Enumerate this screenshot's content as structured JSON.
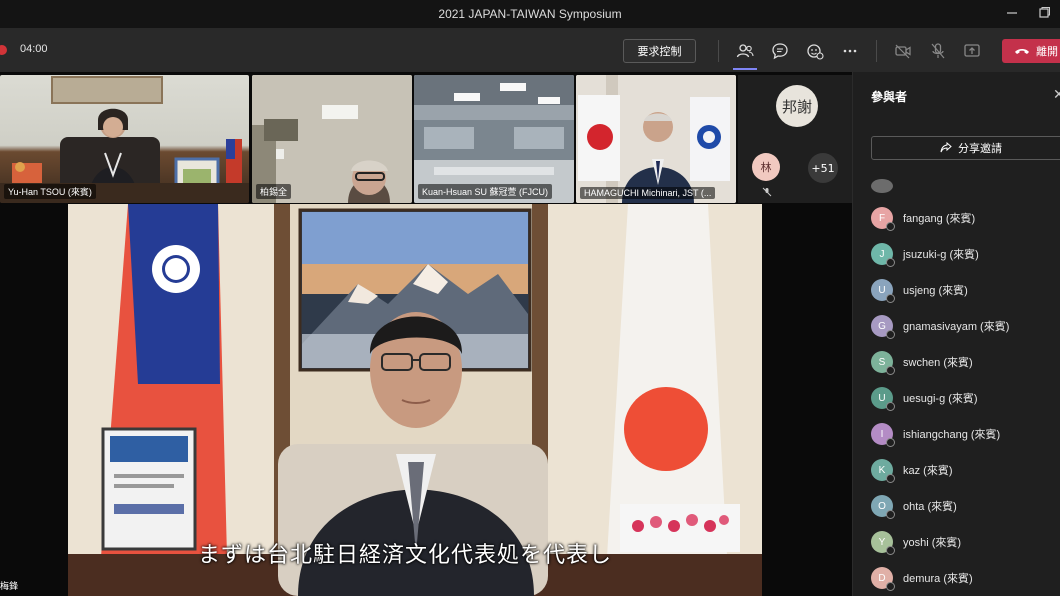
{
  "window": {
    "title": "2021 JAPAN-TAIWAN Symposium"
  },
  "toolbar": {
    "timer": "04:00",
    "request_control_label": "要求控制",
    "leave_label": "離開",
    "icons": [
      "participants-icon",
      "chat-icon",
      "reactions-icon",
      "more-icon",
      "camera-icon",
      "mic-icon",
      "share-icon"
    ]
  },
  "gallery": {
    "tiles": [
      {
        "name": "Yu-Han TSOU (來賓)"
      },
      {
        "name": "柏錫全"
      },
      {
        "name": "Kuan-Hsuan SU 蘇冠萱 (FJCU)"
      },
      {
        "name": "HAMAGUCHI Michinari, JST (..."
      }
    ],
    "mini_avatars": [
      {
        "initials": "邦謝"
      },
      {
        "initials": "林"
      }
    ],
    "overflow_count": "+51"
  },
  "main_video": {
    "subtitle": "まずは台北駐日経済文化代表処を代表し",
    "left_partial_name": "梅鋒"
  },
  "panel": {
    "title": "參與者",
    "share_invite_label": "分享邀請",
    "participants": [
      {
        "initial": "",
        "name": "",
        "color": "#6c6c6c"
      },
      {
        "initial": "F",
        "name": "fangang (來賓)",
        "color": "#e7a4a4"
      },
      {
        "initial": "J",
        "name": "jsuzuki-g (來賓)",
        "color": "#6fb7a9"
      },
      {
        "initial": "U",
        "name": "usjeng (來賓)",
        "color": "#8aa4bd"
      },
      {
        "initial": "G",
        "name": "gnamasivayam (來賓)",
        "color": "#a79ac2"
      },
      {
        "initial": "S",
        "name": "swchen (來賓)",
        "color": "#7db29a"
      },
      {
        "initial": "U",
        "name": "uesugi-g (來賓)",
        "color": "#5b9b8a"
      },
      {
        "initial": "I",
        "name": "ishiangchang (來賓)",
        "color": "#b48cc5"
      },
      {
        "initial": "K",
        "name": "kaz (來賓)",
        "color": "#6eab9f"
      },
      {
        "initial": "O",
        "name": "ohta (來賓)",
        "color": "#7fa7b4"
      },
      {
        "initial": "Y",
        "name": "yoshi (來賓)",
        "color": "#a7c19a"
      },
      {
        "initial": "D",
        "name": "demura (來賓)",
        "color": "#e0b0a7"
      }
    ]
  }
}
